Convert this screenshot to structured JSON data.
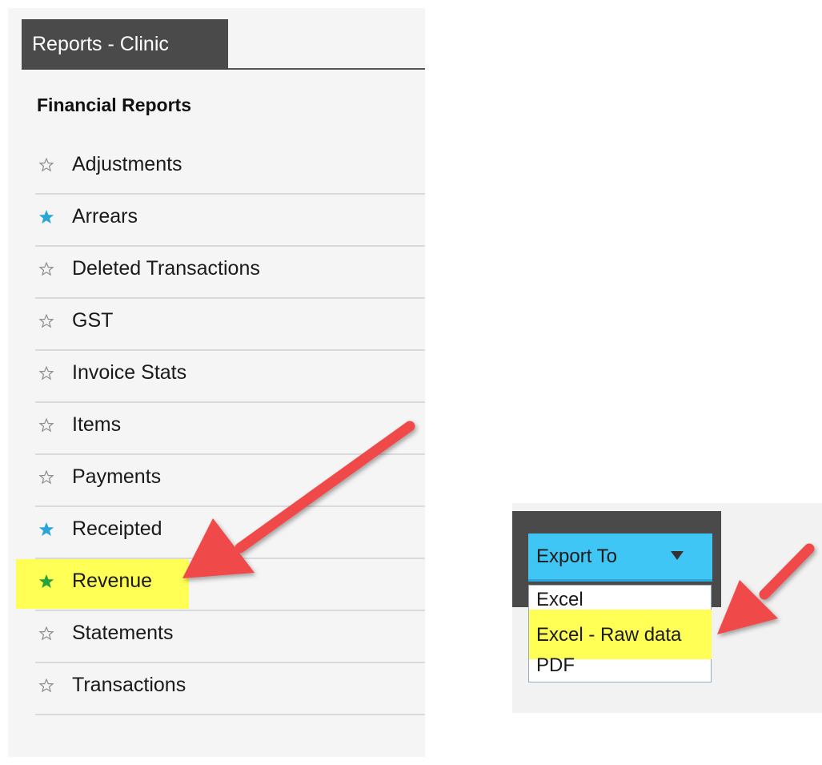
{
  "panel": {
    "tab_title": "Reports - Clinic",
    "section_title": "Financial Reports",
    "items": [
      {
        "label": "Adjustments",
        "starred": false,
        "highlighted": false
      },
      {
        "label": "Arrears",
        "starred": true,
        "star_color": "#2aa7d6",
        "highlighted": false
      },
      {
        "label": "Deleted Transactions",
        "starred": false,
        "highlighted": false
      },
      {
        "label": "GST",
        "starred": false,
        "highlighted": false
      },
      {
        "label": "Invoice Stats",
        "starred": false,
        "highlighted": false
      },
      {
        "label": "Items",
        "starred": false,
        "highlighted": false
      },
      {
        "label": "Payments",
        "starred": false,
        "highlighted": false
      },
      {
        "label": "Receipted",
        "starred": true,
        "star_color": "#2aa7d6",
        "highlighted": false
      },
      {
        "label": "Revenue",
        "starred": true,
        "star_color": "#2aa23c",
        "highlighted": true
      },
      {
        "label": "Statements",
        "starred": false,
        "highlighted": false
      },
      {
        "label": "Transactions",
        "starred": false,
        "highlighted": false
      }
    ]
  },
  "export": {
    "button_label": "Export To",
    "options": [
      {
        "label": "Excel",
        "highlighted": false
      },
      {
        "label": "Excel - Raw data",
        "highlighted": true
      },
      {
        "label": "PDF",
        "highlighted": false
      }
    ]
  },
  "colors": {
    "highlight": "#ffff55",
    "arrow": "#f04848",
    "tab_bg": "#4a4a4a",
    "export_button": "#3fc6f4"
  }
}
